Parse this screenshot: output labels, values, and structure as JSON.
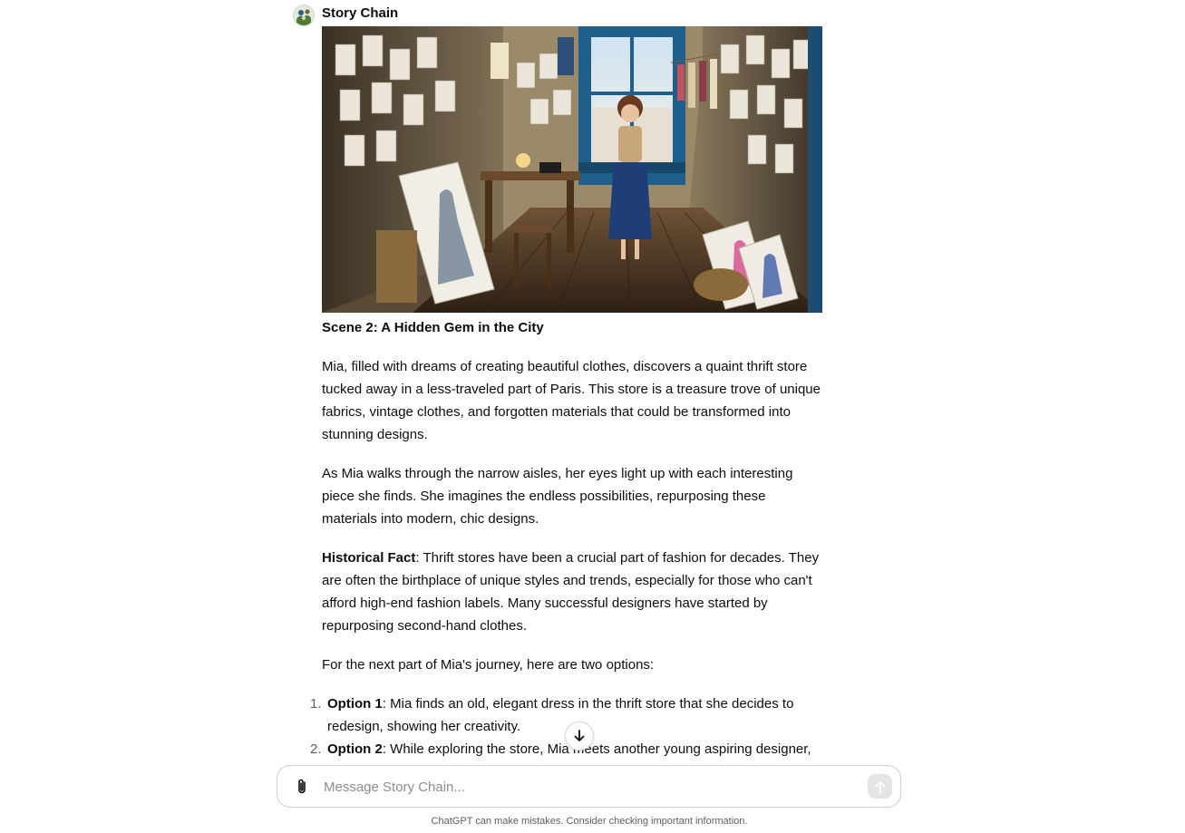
{
  "message": {
    "author": "Story Chain",
    "avatar_icon": "story-chain-avatar-icon",
    "image_alt_subject": "girl-in-atelier-image",
    "scene_title": "Scene 2: A Hidden Gem in the City",
    "paragraphs": [
      "Mia, filled with dreams of creating beautiful clothes, discovers a quaint thrift store tucked away in a less-traveled part of Paris. This store is a treasure trove of unique fabrics, vintage clothes, and forgotten materials that could be transformed into stunning designs.",
      "As Mia walks through the narrow aisles, her eyes light up with each interesting piece she finds. She imagines the endless possibilities, repurposing these materials into modern, chic designs."
    ],
    "fact_label": "Historical Fact",
    "fact_text": ": Thrift stores have been a crucial part of fashion for decades. They are often the birthplace of unique styles and trends, especially for those who can't afford high-end fashion labels. Many successful designers have started by repurposing second-hand clothes.",
    "options_intro": "For the next part of Mia's journey, here are two options:",
    "options": [
      {
        "num": "1.",
        "label": "Option 1",
        "text": ": Mia finds an old, elegant dress in the thrift store that she decides to redesign, showing her creativity."
      },
      {
        "num": "2.",
        "label": "Option 2",
        "text": ": While exploring the store, Mia meets another young aspiring designer,"
      }
    ]
  },
  "composer": {
    "placeholder": "Message Story Chain...",
    "attach_icon": "paperclip-icon",
    "send_icon": "arrow-up-icon"
  },
  "scroll_button_icon": "arrow-down-icon",
  "footer": {
    "disclaimer": "ChatGPT can make mistakes. Consider checking important information."
  },
  "colors": {
    "text": "#0d0d0d",
    "muted": "#5d5d5d",
    "border": "#cfcfcf",
    "send_disabled": "#e5e5e5"
  }
}
